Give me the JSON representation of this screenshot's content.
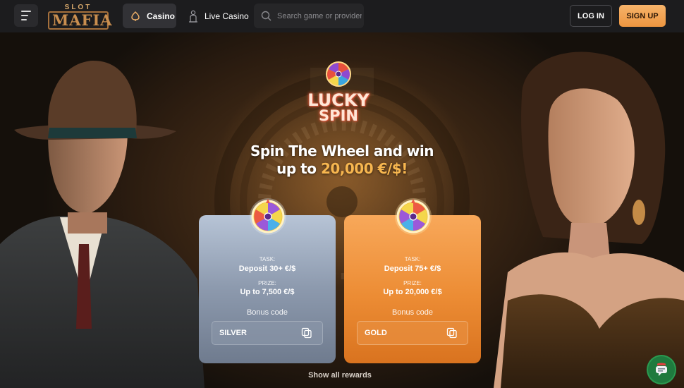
{
  "header": {
    "logo_top": "SLOT",
    "logo_main": "MAFIA",
    "nav": [
      {
        "label": "Casino",
        "icon": "poker-chip-icon",
        "active": true
      },
      {
        "label": "Live Casino",
        "icon": "dealer-icon",
        "active": false
      }
    ],
    "search_placeholder": "Search game or provider",
    "login_label": "LOG IN",
    "signup_label": "SIGN UP"
  },
  "hero": {
    "logo_line1": "LUCKY",
    "logo_line2": "SPIN",
    "headline_line1": "Spin The Wheel and win",
    "headline_prefix": "up to ",
    "headline_amount": "20,000 €/$!",
    "cards": [
      {
        "task_label": "TASK:",
        "task": "Deposit 30+ €/$",
        "prize_label": "PRIZE:",
        "prize": "Up to 7,500 €/$",
        "bonus_label": "Bonus code",
        "code": "SILVER"
      },
      {
        "task_label": "TASK:",
        "task": "Deposit 75+ €/$",
        "prize_label": "PRIZE:",
        "prize": "Up to 20,000 €/$",
        "bonus_label": "Bonus code",
        "code": "GOLD"
      }
    ],
    "show_all": "Show all rewards"
  },
  "colors": {
    "accent": "#f6a958",
    "amount": "#f7b64f",
    "header_bg": "#1c1c1e",
    "chat": "#1f7a3e"
  }
}
